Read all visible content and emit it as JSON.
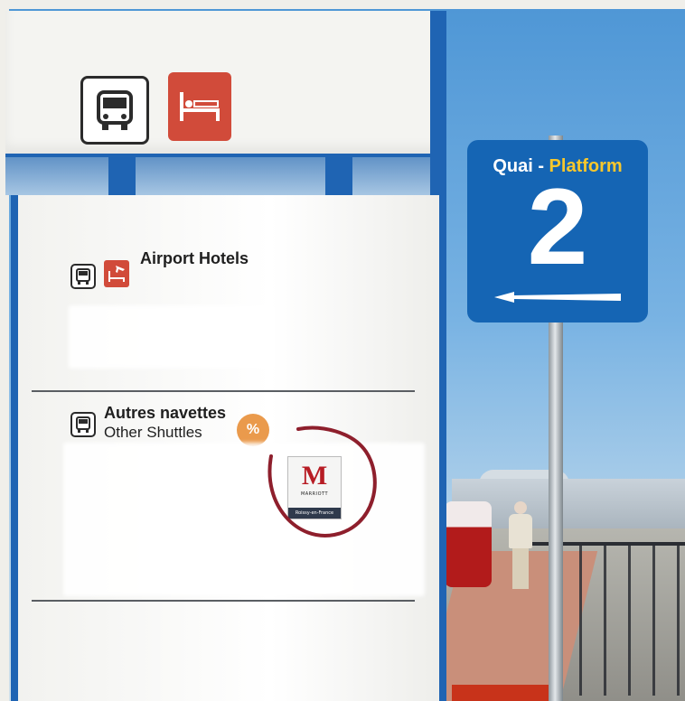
{
  "platform_sign": {
    "label_fr": "Quai -",
    "label_en": "Platform",
    "number": "2",
    "colors": {
      "background": "#1565b4",
      "highlight": "#f7c72c"
    }
  },
  "totem": {
    "top_icons": [
      "bus-icon",
      "bed-icon"
    ],
    "sections": [
      {
        "title": "Airport Hotels",
        "icons": [
          "bus-icon",
          "bed-icon",
          "plane-icon"
        ]
      },
      {
        "title": "Autres navettes",
        "subtitle": "Other Shuttles",
        "icons": [
          "bus-icon"
        ]
      }
    ],
    "discount_badge": "%",
    "marriott_logo": {
      "brand": "MARRIOTT",
      "location": "Roissy-en-France"
    },
    "colors": {
      "frame": "#1f64b3",
      "hotel_red": "#d14b3a",
      "highlight_circle": "#8e1f2c"
    }
  }
}
